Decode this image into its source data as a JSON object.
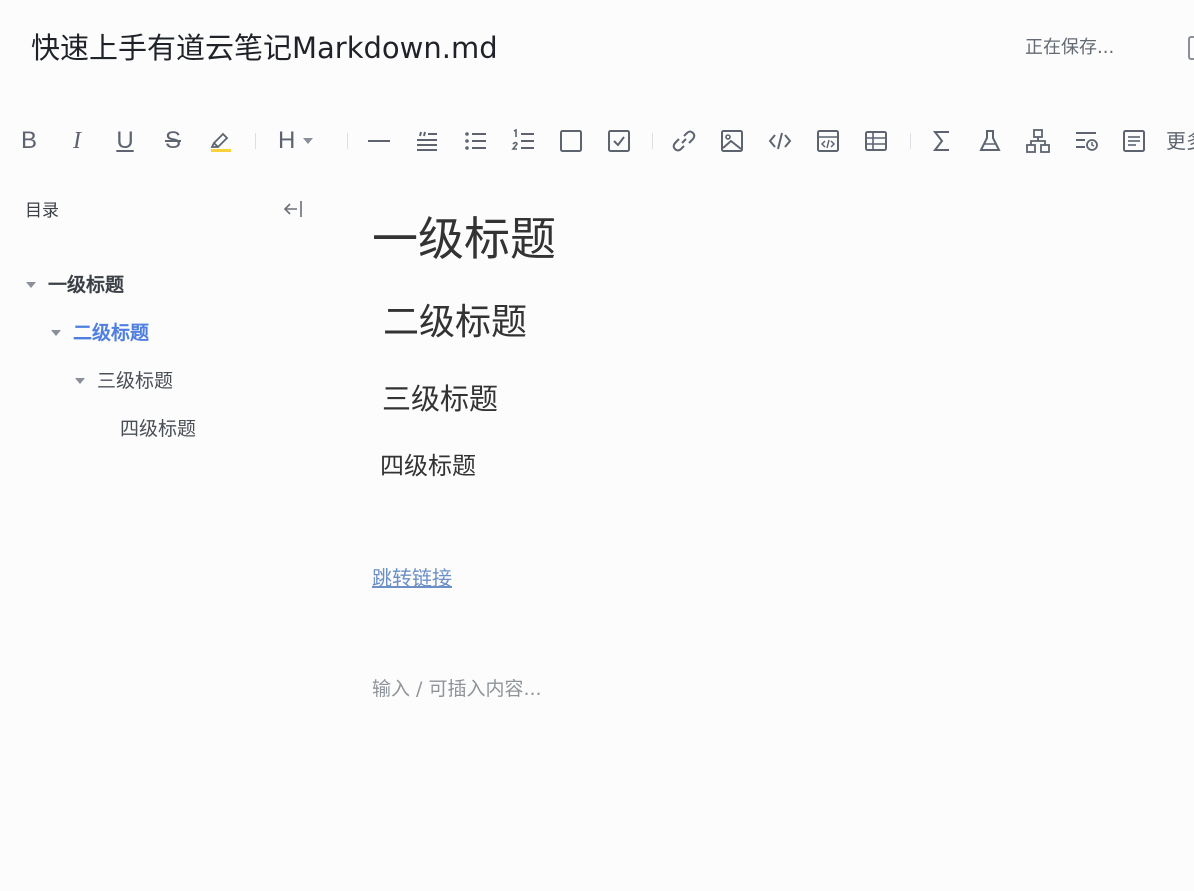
{
  "document": {
    "title": "快速上手有道云笔记Markdown.md",
    "save_status": "正在保存..."
  },
  "toolbar": {
    "buttons": [
      {
        "name": "bold",
        "icon": "bold-icon",
        "label": "B"
      },
      {
        "name": "italic",
        "icon": "italic-icon",
        "label": "I"
      },
      {
        "name": "underline",
        "icon": "underline-icon",
        "label": "U"
      },
      {
        "name": "strikethrough",
        "icon": "strikethrough-icon",
        "label": "S"
      },
      {
        "name": "highlight",
        "icon": "highlighter-icon"
      },
      {
        "name": "heading",
        "icon": "heading-icon",
        "label": "H"
      },
      {
        "name": "horizontal-rule",
        "icon": "horizontal-rule-icon"
      },
      {
        "name": "quote",
        "icon": "quote-icon"
      },
      {
        "name": "bullet-list",
        "icon": "bullet-list-icon"
      },
      {
        "name": "numbered-list",
        "icon": "numbered-list-icon"
      },
      {
        "name": "checkbox",
        "icon": "checkbox-empty-icon"
      },
      {
        "name": "task-list",
        "icon": "checkbox-checked-icon"
      },
      {
        "name": "link",
        "icon": "link-icon"
      },
      {
        "name": "image",
        "icon": "image-icon"
      },
      {
        "name": "code",
        "icon": "code-icon"
      },
      {
        "name": "code-block",
        "icon": "code-block-icon"
      },
      {
        "name": "table",
        "icon": "table-icon"
      },
      {
        "name": "formula",
        "icon": "sigma-icon"
      },
      {
        "name": "flask",
        "icon": "flask-icon"
      },
      {
        "name": "flowchart",
        "icon": "sitemap-icon"
      },
      {
        "name": "timeline",
        "icon": "timeline-icon"
      },
      {
        "name": "document",
        "icon": "document-icon"
      }
    ],
    "more_label": "更多"
  },
  "toc": {
    "title": "目录",
    "collapse_icon": "collapse-left-icon",
    "items": [
      {
        "level": 1,
        "label": "一级标题",
        "active": false
      },
      {
        "level": 2,
        "label": "二级标题",
        "active": true
      },
      {
        "level": 3,
        "label": "三级标题",
        "active": false
      },
      {
        "level": 4,
        "label": "四级标题",
        "active": false
      }
    ]
  },
  "editor": {
    "h1": "一级标题",
    "h2": "二级标题",
    "h3": "三级标题",
    "h4": "四级标题",
    "link_text": "跳转链接",
    "placeholder": "输入 / 可插入内容..."
  },
  "colors": {
    "accent": "#4f7fe0",
    "link": "#6b8fc6",
    "highlight": "#f7d23b",
    "icon": "#5d6470"
  }
}
